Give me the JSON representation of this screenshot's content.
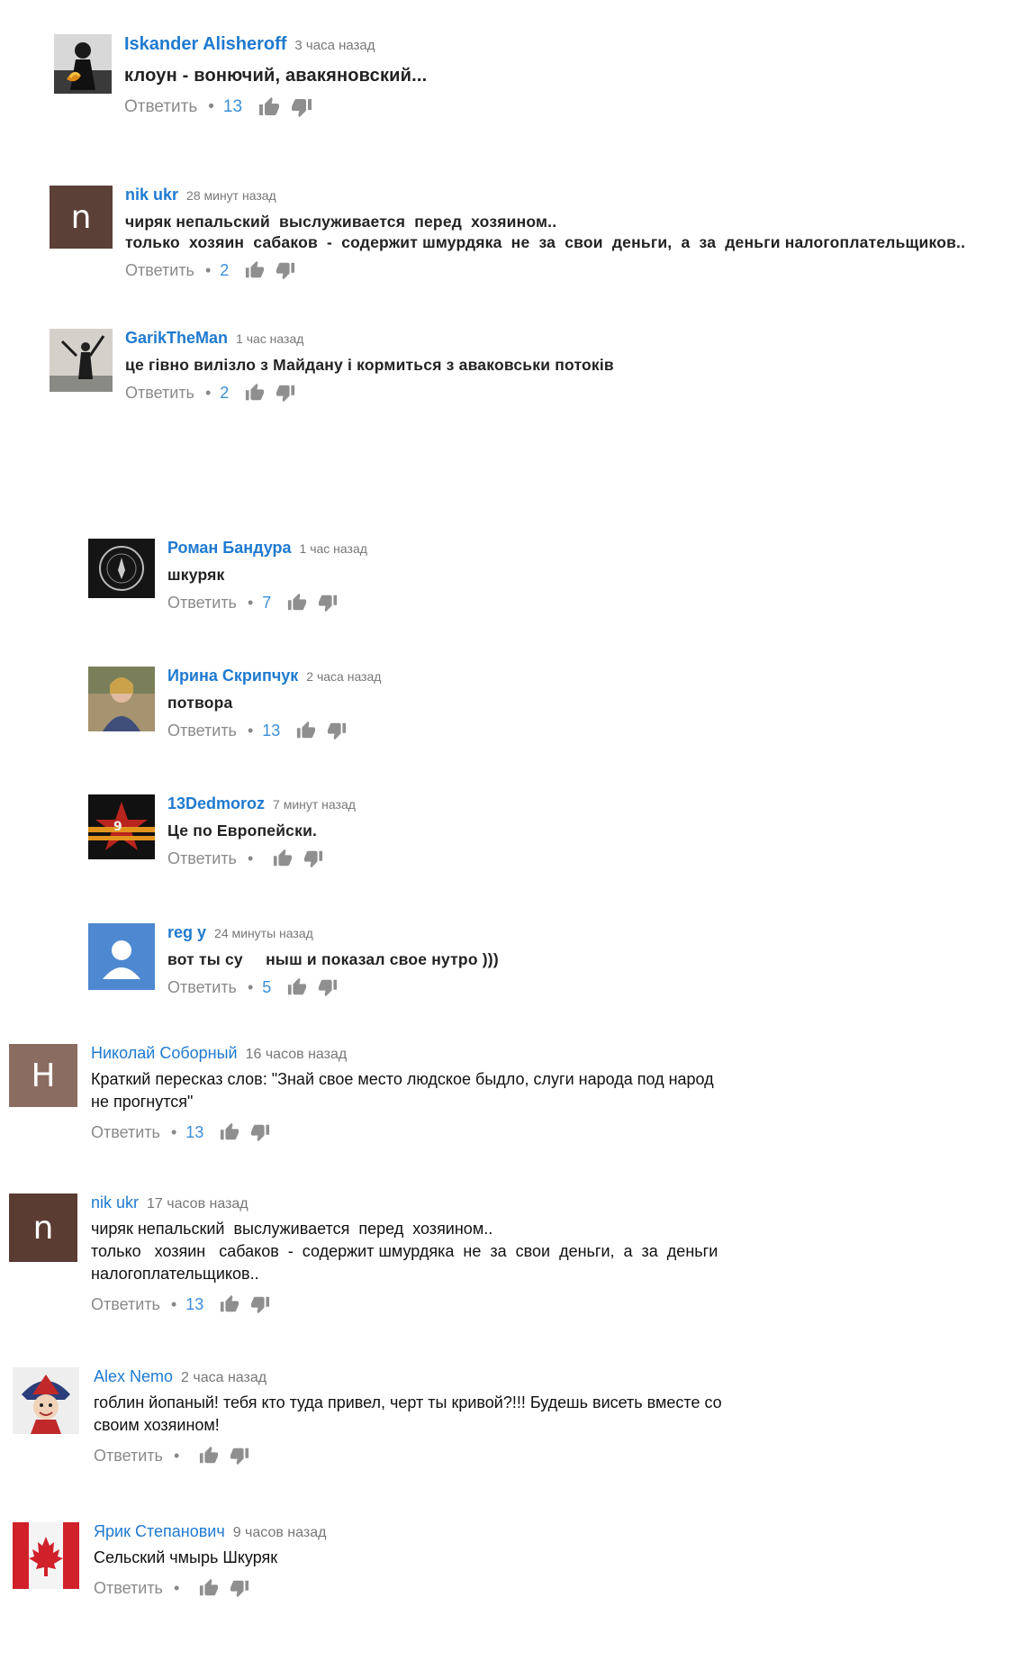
{
  "labels": {
    "reply": "Ответить",
    "like_icon": "thumb-up-icon",
    "dislike_icon": "thumb-down-icon"
  },
  "colors": {
    "author": "#1f7ad0",
    "likes": "#3a8fd9",
    "muted": "#888888"
  },
  "comments": [
    {
      "author": "Iskander Alisheroff",
      "time": "3 часа назад",
      "text": "клоун - вонючий, авакяновский...",
      "likes": "13",
      "avatar": "photo-dark"
    },
    {
      "author": "nik ukr",
      "time": "28 минут назад",
      "text": "чиряк непальский  выслуживается  перед  хозяином..\nтолько  хозяин  сабаков  -  содержит шмурдяка  не  за  свои  деньги,  а  за  деньги налогоплательщиков..",
      "likes": "2",
      "avatar": "n"
    },
    {
      "author": "GarikTheMan",
      "time": "1 час назад",
      "text": "це гівно вилізло з Майдану і кормиться з аваковськи потоків",
      "likes": "2",
      "avatar": "photo-figure"
    },
    {
      "author": "Роман Бандура",
      "time": "1 час назад",
      "text": "шкуряк",
      "likes": "7",
      "avatar": "photo-emblem"
    },
    {
      "author": "Ирина Скрипчук",
      "time": "2 часа назад",
      "text": "потвора",
      "likes": "13",
      "avatar": "photo-woman"
    },
    {
      "author": "13Dedmoroz",
      "time": "7 минут назад",
      "text": "Це по Европейски.",
      "likes": "",
      "avatar": "photo-star"
    },
    {
      "author": "reg y",
      "time": "24 минуты назад",
      "text": "вот ты су     ныш и показал свое нутро )))",
      "likes": "5",
      "avatar": "default-user"
    },
    {
      "author": "Николай Соборный",
      "time": "16 часов назад",
      "text": "Краткий пересказ слов: \"Знай свое место людское быдло, слуги народа под народ\nне прогнутся\"",
      "likes": "13",
      "avatar": "H"
    },
    {
      "author": "nik ukr",
      "time": "17 часов назад",
      "text": "чиряк непальский  выслуживается  перед  хозяином..\nтолько   хозяин   сабаков  -  содержит шмурдяка  не  за  свои  деньги,  а  за  деньги\nналогоплательщиков..",
      "likes": "13",
      "avatar": "n"
    },
    {
      "author": "Alex Nemo",
      "time": "2 часа назад",
      "text": "гоблин йопаный! тебя кто туда привел, черт ты кривой?!!! Будешь висеть вместе со\nсвоим хозяином!",
      "likes": "",
      "avatar": "photo-jester"
    },
    {
      "author": "Ярик Степанович",
      "time": "9 часов назад",
      "text": "Сельский чмырь Шкуряк",
      "likes": "",
      "avatar": "photo-flag"
    }
  ]
}
